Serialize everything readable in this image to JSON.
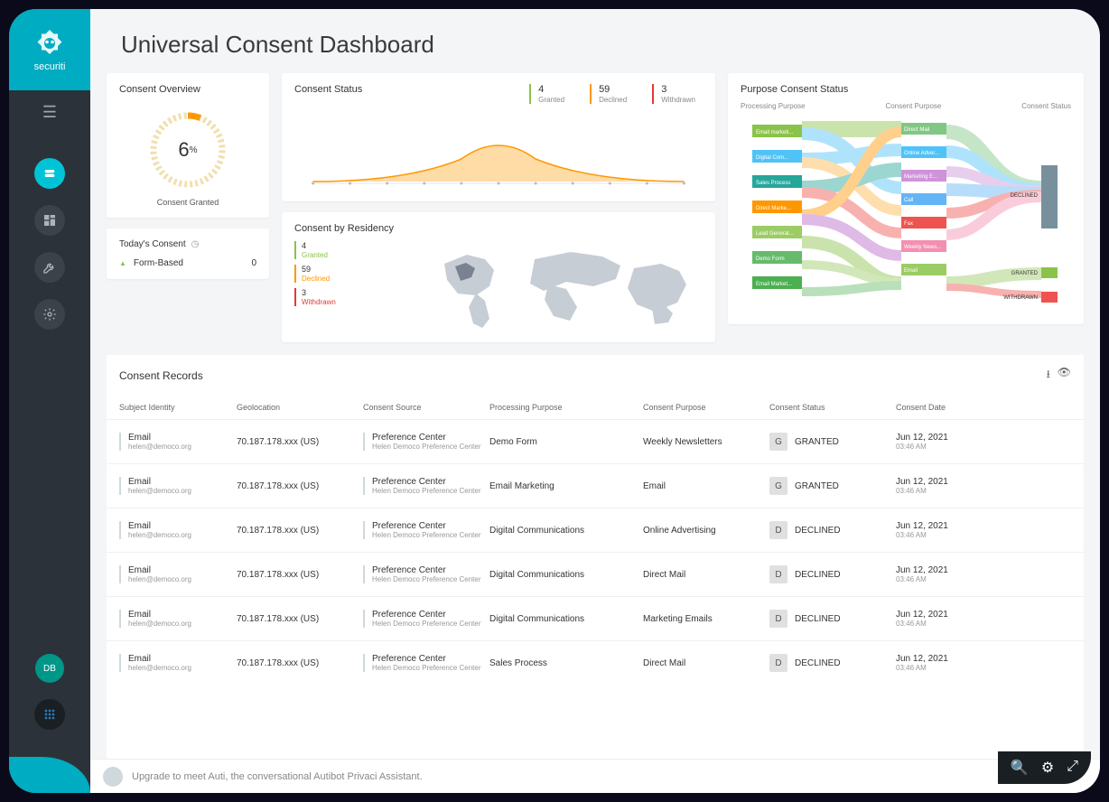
{
  "brand": {
    "name": "securiti",
    "avatar_initials": "DB"
  },
  "page_title": "Universal Consent Dashboard",
  "overview": {
    "title": "Consent Overview",
    "value": 6,
    "unit": "%",
    "label": "Consent Granted"
  },
  "today": {
    "title": "Today's Consent",
    "rows": [
      {
        "label": "Form-Based",
        "count": 0
      }
    ]
  },
  "status_card": {
    "title": "Consent Status",
    "stats": {
      "granted": 4,
      "declined": 59,
      "withdrawn": 3
    },
    "labels": {
      "granted": "Granted",
      "declined": "Declined",
      "withdrawn": "Withdrawn"
    }
  },
  "residency": {
    "title": "Consent by Residency",
    "stats": {
      "granted": 4,
      "declined": 59,
      "withdrawn": 3
    },
    "labels": {
      "granted": "Granted",
      "declined": "Declined",
      "withdrawn": "Withdrawn"
    }
  },
  "sankey": {
    "title": "Purpose Consent Status",
    "headers": {
      "a": "Processing Purpose",
      "b": "Consent Purpose",
      "c": "Consent Status"
    },
    "left": [
      "Email marketi...",
      "Digital Com...",
      "Sales Process",
      "Direct Marke...",
      "Lead Generat...",
      "Demo Form",
      "Email Market..."
    ],
    "mid": [
      "Direct Mail",
      "Online Adver...",
      "Marketing E...",
      "Call",
      "Fax",
      "Weekly News...",
      "Email"
    ],
    "right": [
      "DECLINED",
      "GRANTED",
      "WITHDRAWN"
    ]
  },
  "records": {
    "title": "Consent Records",
    "columns": [
      "Subject Identity",
      "Geolocation",
      "Consent Source",
      "Processing Purpose",
      "Consent Purpose",
      "Consent Status",
      "Consent Date"
    ],
    "rows": [
      {
        "id_type": "Email",
        "id_value": "helen@democo.org",
        "geo": "70.187.178.xxx (US)",
        "src": "Preference Center",
        "src_sub": "Helen Democo Preference Center",
        "proc": "Demo Form",
        "purpose": "Weekly Newsletters",
        "status": "GRANTED",
        "badge": "G",
        "date": "Jun 12, 2021",
        "time": "03:46 AM"
      },
      {
        "id_type": "Email",
        "id_value": "helen@democo.org",
        "geo": "70.187.178.xxx (US)",
        "src": "Preference Center",
        "src_sub": "Helen Democo Preference Center",
        "proc": "Email Marketing",
        "purpose": "Email",
        "status": "GRANTED",
        "badge": "G",
        "date": "Jun 12, 2021",
        "time": "03:46 AM"
      },
      {
        "id_type": "Email",
        "id_value": "helen@democo.org",
        "geo": "70.187.178.xxx (US)",
        "src": "Preference Center",
        "src_sub": "Helen Democo Preference Center",
        "proc": "Digital Communications",
        "purpose": "Online Advertising",
        "status": "DECLINED",
        "badge": "D",
        "date": "Jun 12, 2021",
        "time": "03:46 AM"
      },
      {
        "id_type": "Email",
        "id_value": "helen@democo.org",
        "geo": "70.187.178.xxx (US)",
        "src": "Preference Center",
        "src_sub": "Helen Democo Preference Center",
        "proc": "Digital Communications",
        "purpose": "Direct Mail",
        "status": "DECLINED",
        "badge": "D",
        "date": "Jun 12, 2021",
        "time": "03:46 AM"
      },
      {
        "id_type": "Email",
        "id_value": "helen@democo.org",
        "geo": "70.187.178.xxx (US)",
        "src": "Preference Center",
        "src_sub": "Helen Democo Preference Center",
        "proc": "Digital Communications",
        "purpose": "Marketing Emails",
        "status": "DECLINED",
        "badge": "D",
        "date": "Jun 12, 2021",
        "time": "03:46 AM"
      },
      {
        "id_type": "Email",
        "id_value": "helen@democo.org",
        "geo": "70.187.178.xxx (US)",
        "src": "Preference Center",
        "src_sub": "Helen Democo Preference Center",
        "proc": "Sales Process",
        "purpose": "Direct Mail",
        "status": "DECLINED",
        "badge": "D",
        "date": "Jun 12, 2021",
        "time": "03:46 AM"
      }
    ]
  },
  "footer": {
    "text": "Upgrade to meet Auti, the conversational Autibot Privaci Assistant."
  },
  "colors": {
    "accent": "#00acc1",
    "granted": "#8bc34a",
    "declined": "#ff9800",
    "withdrawn": "#e53935"
  },
  "chart_data": [
    {
      "type": "area",
      "title": "Consent Status",
      "x": [
        0,
        1,
        2,
        3,
        4,
        5,
        6,
        7,
        8,
        9,
        10
      ],
      "values": [
        0,
        0,
        1,
        3,
        8,
        14,
        18,
        14,
        8,
        3,
        1
      ]
    },
    {
      "type": "bar",
      "title": "Consent by Residency",
      "categories": [
        "Granted",
        "Declined",
        "Withdrawn"
      ],
      "values": [
        4,
        59,
        3
      ]
    }
  ]
}
